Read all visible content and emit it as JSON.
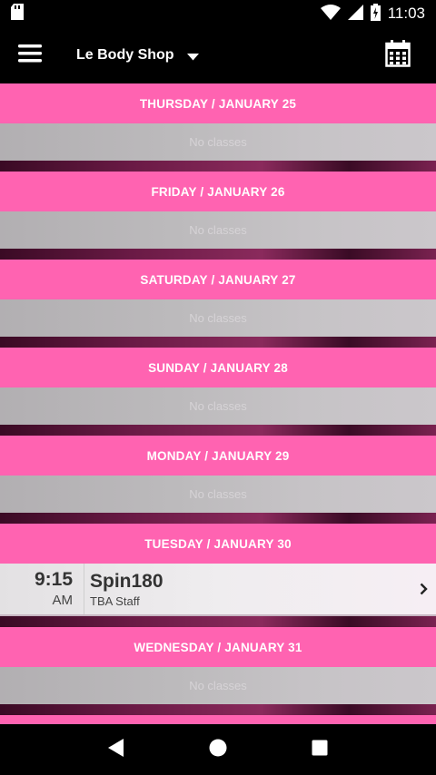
{
  "status_bar": {
    "time": "11:03",
    "icons": [
      "sd-card-icon",
      "wifi-icon",
      "cell-signal-icon",
      "battery-charging-icon"
    ]
  },
  "app_bar": {
    "location": "Le Body Shop",
    "menu_icon": "hamburger-menu-icon",
    "dropdown_icon": "caret-down-icon",
    "calendar_icon": "calendar-icon"
  },
  "colors": {
    "header_pink": "#ff63b1",
    "bars": "#000000"
  },
  "schedule": [
    {
      "date_label": "THURSDAY / JANUARY 25",
      "empty_label": "No classes"
    },
    {
      "date_label": "FRIDAY / JANUARY 26",
      "empty_label": "No classes"
    },
    {
      "date_label": "SATURDAY / JANUARY 27",
      "empty_label": "No classes"
    },
    {
      "date_label": "SUNDAY / JANUARY 28",
      "empty_label": "No classes"
    },
    {
      "date_label": "MONDAY / JANUARY 29",
      "empty_label": "No classes"
    },
    {
      "date_label": "TUESDAY / JANUARY 30",
      "classes": [
        {
          "time": "9:15",
          "ampm": "AM",
          "name": "Spin180",
          "staff": "TBA Staff"
        }
      ]
    },
    {
      "date_label": "WEDNESDAY / JANUARY 31",
      "empty_label": "No classes"
    }
  ],
  "nav_bar": {
    "icons": [
      "back-icon",
      "home-icon",
      "recents-icon"
    ]
  }
}
